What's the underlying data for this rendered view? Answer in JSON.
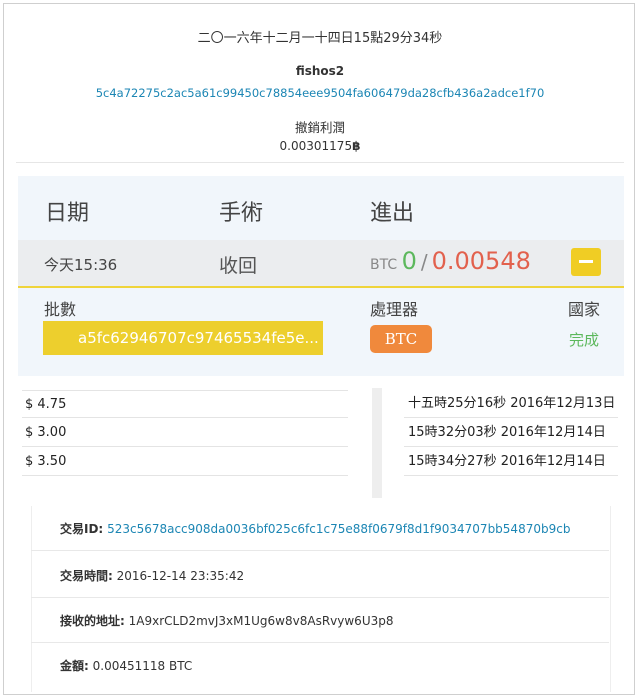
{
  "header": {
    "date_text": "二〇一六年十二月一十四日15點29分34秒",
    "username": "fishos2",
    "hash": "5c4a72275c2ac5a61c99450c78854eee9504fa606479da28cfb436a2adce1f70",
    "profit_label": "撤銷利潤",
    "profit_amount": "0.00301175",
    "btc_symbol": "฿"
  },
  "table": {
    "col_date": "日期",
    "col_operation": "手術",
    "col_inout": "進出",
    "row": {
      "date": "今天15:36",
      "operation": "收回",
      "currency": "BTC",
      "in_value": "0",
      "separator": "/",
      "out_value": "0.00548"
    },
    "batch_label": "批數",
    "processor_label": "處理器",
    "country_label": "國家",
    "batch_id": "a5fc62946707c97465534fe5e...",
    "processor_badge": "BTC",
    "status": "完成"
  },
  "prices": [
    "$ 4.75",
    "$ 3.00",
    "$ 3.50"
  ],
  "times": [
    "十五時25分16秒 2016年12月13日",
    "15時32分03秒 2016年12月14日",
    "15時34分27秒 2016年12月14日"
  ],
  "details": {
    "txid_label": "交易ID:",
    "txid_value": "523c5678acc908da0036bf025c6fc1c75e88f0679f8d1f9034707bb54870b9cb",
    "time_label": "交易時間:",
    "time_value": "2016-12-14 23:35:42",
    "address_label": "接收的地址:",
    "address_value": "1A9xrCLD2mvJ3xM1Ug6w8v8AsRvyw6U3p8",
    "amount_label": "金額:",
    "amount_value": "0.00451118 BTC"
  },
  "colors": {
    "accent_yellow": "#edcf2d",
    "link_blue": "#1c86b4",
    "green": "#5cb85c",
    "red": "#e2614d",
    "orange": "#f0893c"
  }
}
